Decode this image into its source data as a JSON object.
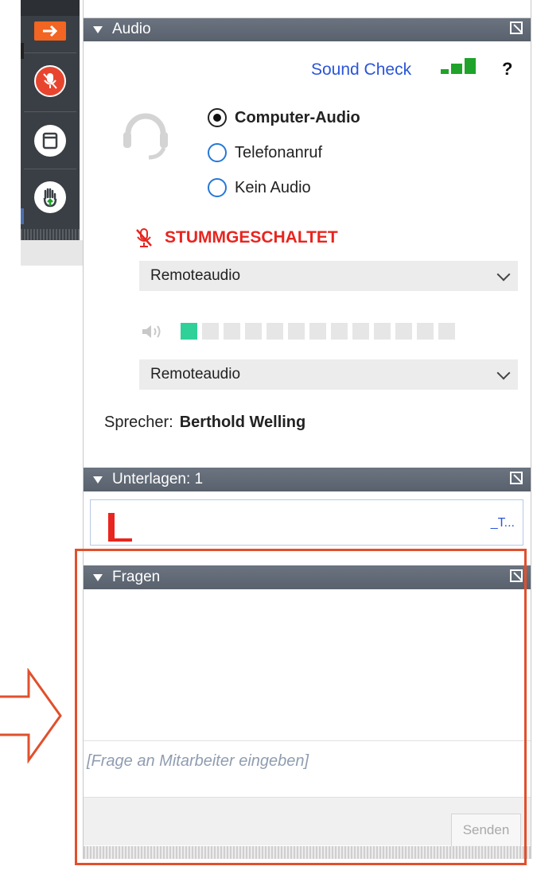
{
  "audio": {
    "header_title": "Audio",
    "sound_check_label": "Sound Check",
    "help_label": "?",
    "options": [
      {
        "label": "Computer-Audio",
        "selected": true
      },
      {
        "label": "Telefonanruf",
        "selected": false
      },
      {
        "label": "Kein Audio",
        "selected": false
      }
    ],
    "mute_status": "STUMMGESCHALTET",
    "microphone_select_value": "Remoteaudio",
    "speaker_select_value": "Remoteaudio",
    "level_segments_total": 13,
    "level_segments_active": 1,
    "speaker_label": "Sprecher:",
    "speaker_name": "Berthold Welling"
  },
  "documents": {
    "header_title": "Unterlagen: 1",
    "item_link": "_T..."
  },
  "questions": {
    "header_title": "Fragen",
    "input_placeholder": "[Frage an Mitarbeiter eingeben]",
    "send_label": "Senden"
  },
  "colors": {
    "header_bar": "#5f6873",
    "accent_orange": "#f26522",
    "mute_red": "#e8251f",
    "link_blue": "#2a55d9",
    "level_green": "#2fd199",
    "signal_green": "#1fa32a",
    "highlight": "#e0502c"
  }
}
